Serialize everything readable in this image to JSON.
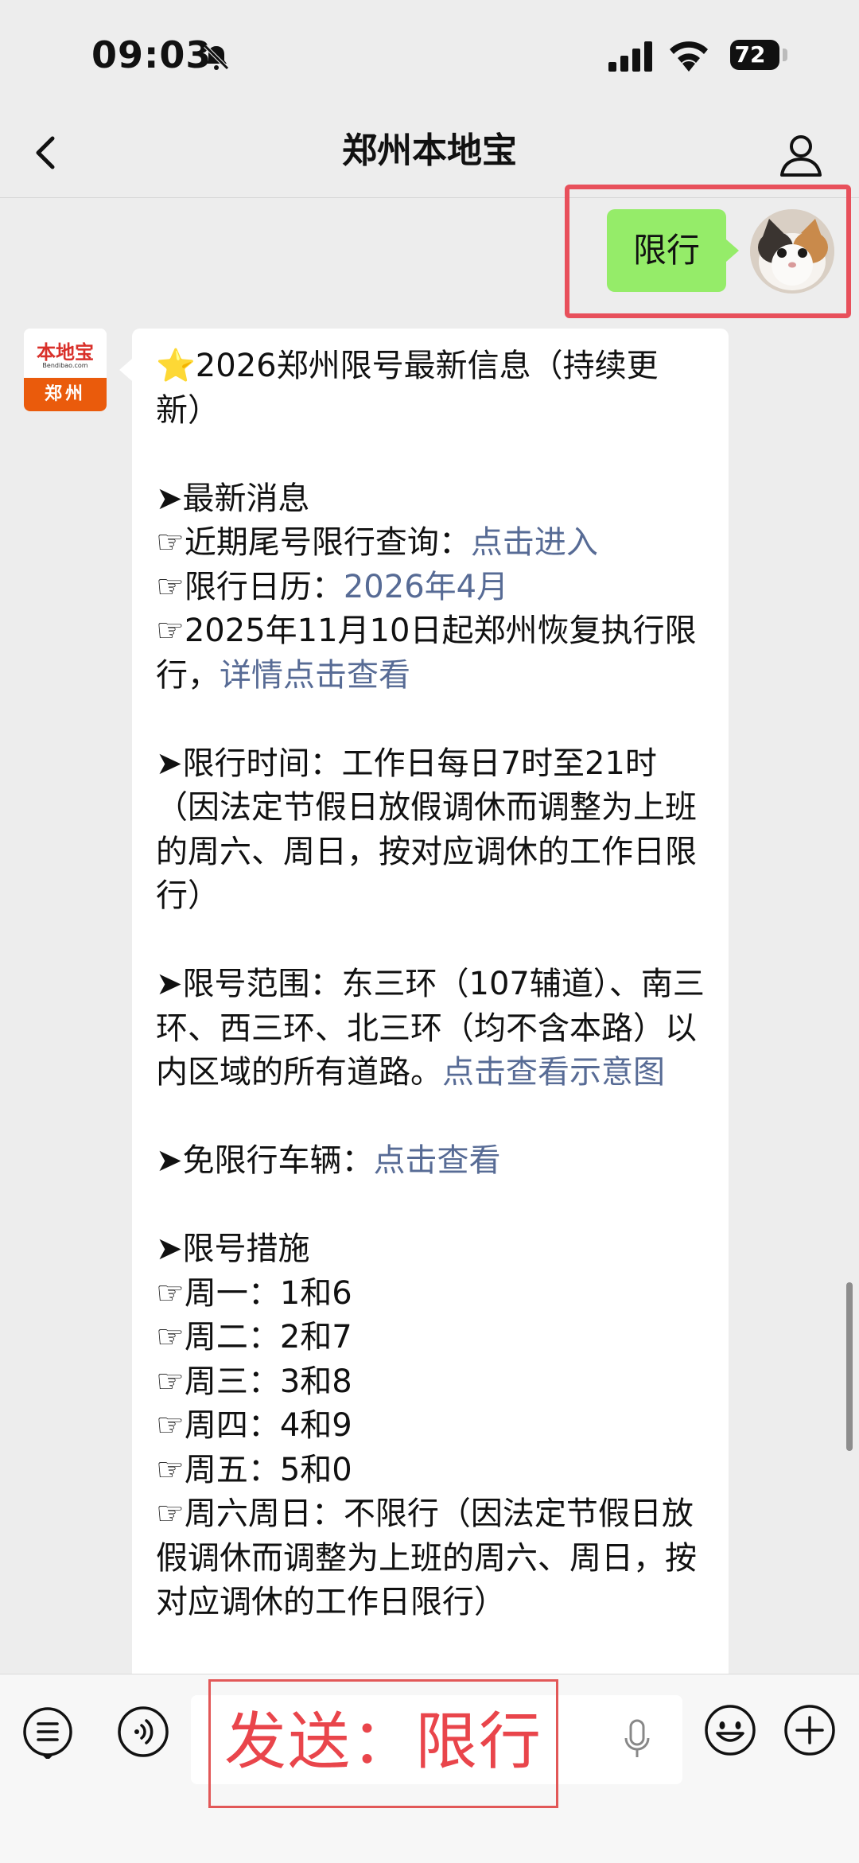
{
  "status_bar": {
    "time": "09:03",
    "battery": "72"
  },
  "nav": {
    "title": "郑州本地宝"
  },
  "my_message": {
    "text": "限行"
  },
  "bot": {
    "avatar_logo": "本地宝",
    "avatar_site": "Bendibao.com",
    "avatar_city": "郑州",
    "lines": [
      {
        "type": "text",
        "text": "⭐2026郑州限号最新信息（持续更新）"
      },
      {
        "type": "gap"
      },
      {
        "type": "text",
        "text": "➤最新消息"
      },
      {
        "type": "mixed",
        "text": "☞近期尾号限行查询：",
        "link": "点击进入"
      },
      {
        "type": "mixed",
        "text": "☞限行日历：",
        "link": "2026年4月"
      },
      {
        "type": "mixed",
        "text": "☞2025年11月10日起郑州恢复执行限行，",
        "link": "详情点击查看"
      },
      {
        "type": "gap"
      },
      {
        "type": "text",
        "text": "➤限行时间：工作日每日7时至21时（因法定节假日放假调休而调整为上班的周六、周日，按对应调休的工作日限行）"
      },
      {
        "type": "gap"
      },
      {
        "type": "mixed",
        "text": "➤限号范围：东三环（107辅道）、南三环、西三环、北三环（均不含本路）以内区域的所有道路。",
        "link": "点击查看示意图"
      },
      {
        "type": "gap"
      },
      {
        "type": "mixed",
        "text": "➤免限行车辆：",
        "link": "点击查看"
      },
      {
        "type": "gap"
      },
      {
        "type": "text",
        "text": "➤限号措施"
      },
      {
        "type": "text",
        "text": "☞周一：1和6"
      },
      {
        "type": "text",
        "text": "☞周二：2和7"
      },
      {
        "type": "text",
        "text": "☞周三：3和8"
      },
      {
        "type": "text",
        "text": "☞周四：4和9"
      },
      {
        "type": "text",
        "text": "☞周五：5和0"
      },
      {
        "type": "text",
        "text": "☞周六周日：不限行（因法定节假日放假调休而调整为上班的周六、周日，按对应调休的工作日限行）"
      }
    ]
  },
  "input": {
    "overlay_text": "发送：限行"
  },
  "colors": {
    "accent_link": "#576b95",
    "my_bubble": "#95ec69",
    "highlight": "#e8505b"
  }
}
